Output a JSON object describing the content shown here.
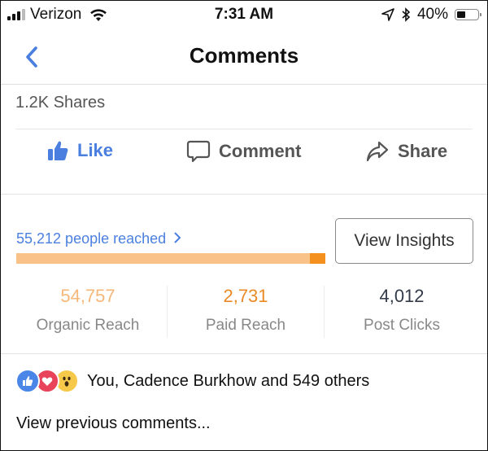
{
  "status_bar": {
    "carrier": "Verizon",
    "time": "7:31 AM",
    "battery_percent_label": "40%",
    "battery_level": 0.4,
    "signal_bars": 3,
    "signal_bars_total": 4
  },
  "nav": {
    "title": "Comments",
    "back_icon": "chevron-left-icon"
  },
  "post": {
    "shares_label": "1.2K Shares",
    "actions": [
      {
        "label": "Like",
        "icon": "thumbs-up-icon",
        "active": true
      },
      {
        "label": "Comment",
        "icon": "speech-bubble-icon",
        "active": false
      },
      {
        "label": "Share",
        "icon": "share-arrow-icon",
        "active": false
      }
    ]
  },
  "insights": {
    "people_reached_label": "55,212 people reached",
    "view_insights_label": "View Insights",
    "reach_breakdown": {
      "organic": 54757,
      "paid": 2731
    },
    "paid_fraction": 0.05,
    "stats": [
      {
        "value": "54,757",
        "label": "Organic Reach",
        "color": "#f5b87a"
      },
      {
        "value": "2,731",
        "label": "Paid Reach",
        "color": "#ea8a26"
      },
      {
        "value": "4,012",
        "label": "Post Clicks",
        "color": "#333a48"
      }
    ],
    "colors": {
      "link": "#4a7fe0",
      "organic_bar": "#f9c288",
      "paid_bar": "#f4901e"
    }
  },
  "reactions": {
    "icons": [
      "like-reaction-icon",
      "love-reaction-icon",
      "wow-reaction-icon"
    ],
    "summary": "You, Cadence Burkhow and 549 others"
  },
  "comments": {
    "view_previous_label": "View previous comments..."
  }
}
